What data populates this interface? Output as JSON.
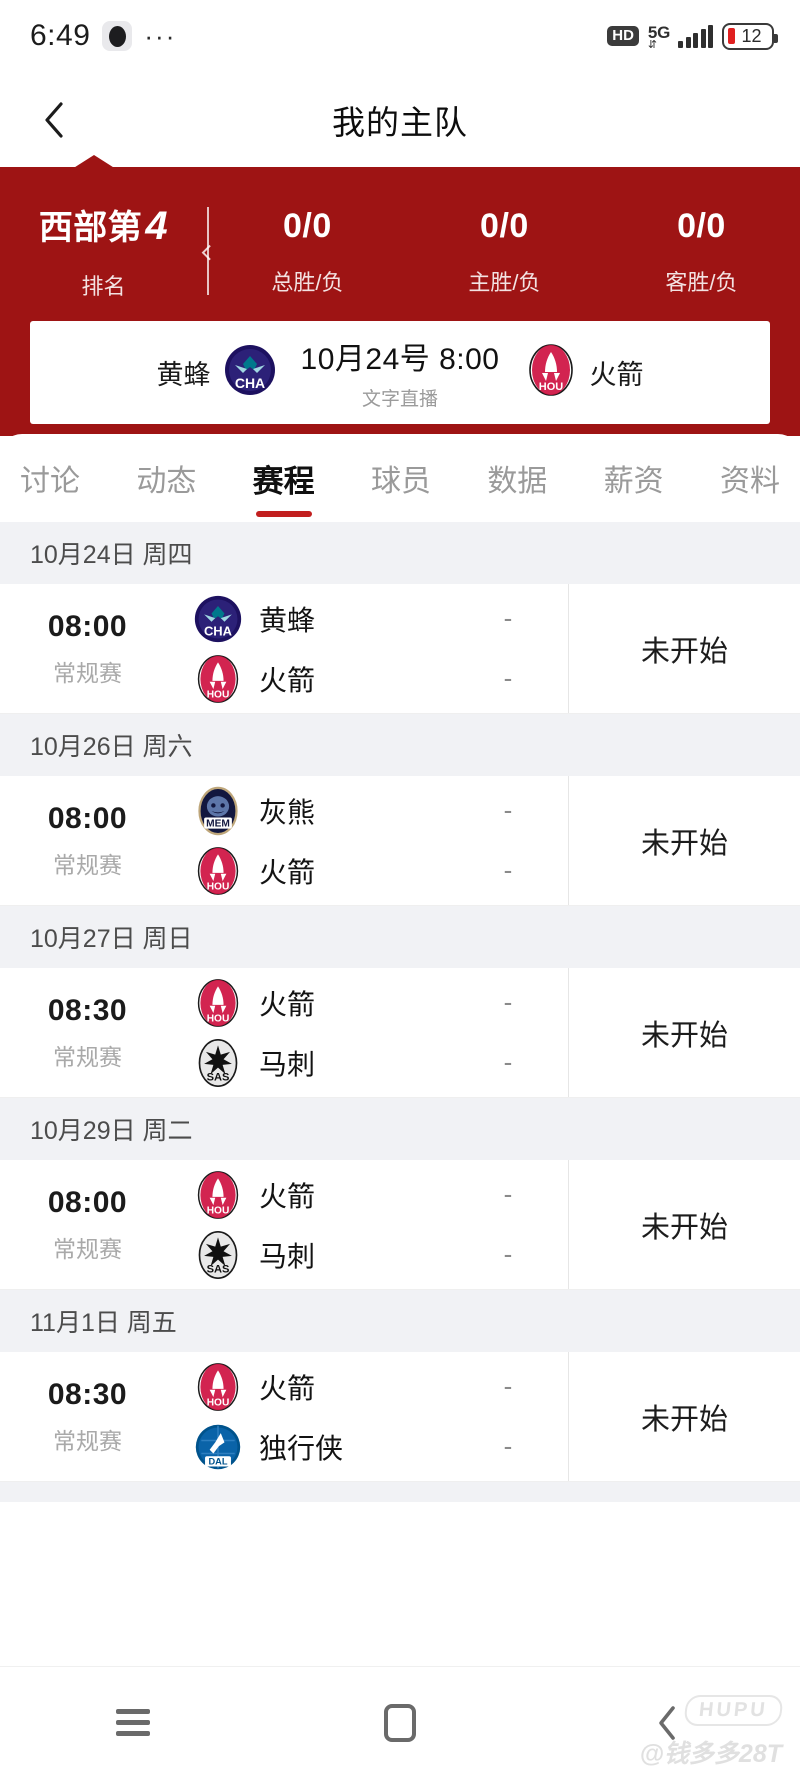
{
  "statusbar": {
    "time": "6:49",
    "hd_label": "HD",
    "network": "5G",
    "battery_level": "12",
    "dots": "···"
  },
  "navbar": {
    "back_icon": "chevron-left-icon",
    "title": "我的主队"
  },
  "hero": {
    "stats": [
      {
        "value": "西部第",
        "value_num": "4",
        "label": "排名"
      },
      {
        "value": "0/0",
        "label": "总胜/负"
      },
      {
        "value": "0/0",
        "label": "主胜/负"
      },
      {
        "value": "0/0",
        "label": "客胜/负"
      }
    ],
    "game_card": {
      "home_team": "黄蜂",
      "home_logo": "cha-hornets-logo",
      "away_team": "火箭",
      "away_logo": "hou-rockets-logo",
      "datetime": "10月24号 8:00",
      "broadcast": "文字直播"
    },
    "accent_color": "#9E1414"
  },
  "tabs": {
    "items": [
      {
        "label": "讨论",
        "active": false
      },
      {
        "label": "动态",
        "active": false
      },
      {
        "label": "赛程",
        "active": true
      },
      {
        "label": "球员",
        "active": false
      },
      {
        "label": "数据",
        "active": false
      },
      {
        "label": "薪资",
        "active": false
      },
      {
        "label": "资料",
        "active": false
      }
    ],
    "indicator_color": "#C21F1F"
  },
  "schedule": {
    "groups": [
      {
        "date": "10月24日 周四",
        "games": [
          {
            "time": "08:00",
            "kind": "常规赛",
            "teams": [
              {
                "name": "黄蜂",
                "logo": "cha-hornets-logo",
                "score": "-"
              },
              {
                "name": "火箭",
                "logo": "hou-rockets-logo",
                "score": "-"
              }
            ],
            "status": "未开始"
          }
        ]
      },
      {
        "date": "10月26日 周六",
        "games": [
          {
            "time": "08:00",
            "kind": "常规赛",
            "teams": [
              {
                "name": "灰熊",
                "logo": "mem-grizzlies-logo",
                "score": "-"
              },
              {
                "name": "火箭",
                "logo": "hou-rockets-logo",
                "score": "-"
              }
            ],
            "status": "未开始"
          }
        ]
      },
      {
        "date": "10月27日 周日",
        "games": [
          {
            "time": "08:30",
            "kind": "常规赛",
            "teams": [
              {
                "name": "火箭",
                "logo": "hou-rockets-logo",
                "score": "-"
              },
              {
                "name": "马刺",
                "logo": "sas-spurs-logo",
                "score": "-"
              }
            ],
            "status": "未开始"
          }
        ]
      },
      {
        "date": "10月29日 周二",
        "games": [
          {
            "time": "08:00",
            "kind": "常规赛",
            "teams": [
              {
                "name": "火箭",
                "logo": "hou-rockets-logo",
                "score": "-"
              },
              {
                "name": "马刺",
                "logo": "sas-spurs-logo",
                "score": "-"
              }
            ],
            "status": "未开始"
          }
        ]
      },
      {
        "date": "11月1日 周五",
        "games": [
          {
            "time": "08:30",
            "kind": "常规赛",
            "teams": [
              {
                "name": "火箭",
                "logo": "hou-rockets-logo",
                "score": "-"
              },
              {
                "name": "独行侠",
                "logo": "dal-mavericks-logo",
                "score": "-"
              }
            ],
            "status": "未开始"
          }
        ]
      }
    ]
  },
  "bottom_nav": {
    "menu_icon": "hamburger-icon",
    "home_icon": "home-square-icon",
    "back_icon": "chevron-left-icon"
  },
  "watermark": {
    "logo": "HUPU",
    "user": "@钱多多28T"
  }
}
